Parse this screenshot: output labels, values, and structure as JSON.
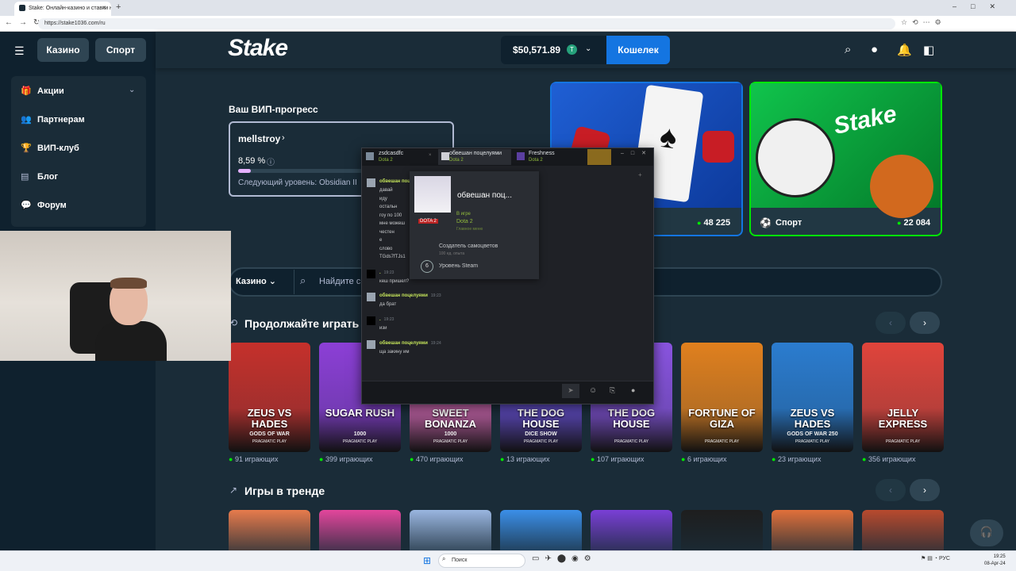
{
  "browser": {
    "tab_title": "Stake: Онлайн-казино и ставки н...",
    "url": "https://stake1036.com/ru",
    "new_tab": "+",
    "tab_close": "×"
  },
  "sidebar": {
    "casino_label": "Казино",
    "sport_label": "Спорт",
    "items": [
      {
        "label": "Акции",
        "icon": "gift-icon"
      },
      {
        "label": "Партнерам",
        "icon": "users-icon"
      },
      {
        "label": "ВИП-клуб",
        "icon": "trophy-icon"
      },
      {
        "label": "Блог",
        "icon": "blog-icon"
      },
      {
        "label": "Форум",
        "icon": "chat-icon"
      }
    ]
  },
  "header": {
    "logo": "Stake",
    "balance": "$50,571.89",
    "coin": "T",
    "wallet_label": "Кошелек"
  },
  "vip": {
    "title": "Ваш ВИП-прогресс",
    "username": "mellstroy",
    "percent_label": "8,59 %",
    "progress": 0.0859,
    "next_level": "Следующий уровень: Obsidian II"
  },
  "promo": {
    "casino_count": "48 225",
    "sport_label": "Спорт",
    "sport_count": "22 084"
  },
  "search": {
    "category": "Казино",
    "placeholder": "Найдите с"
  },
  "continue_section": {
    "title": "Продолжайте играть",
    "games": [
      {
        "name": "ZEUS VS HADES",
        "sub": "GODS OF WAR",
        "provider": "PRAGMATIC PLAY",
        "players": "91 играющих",
        "color": "#c5302b"
      },
      {
        "name": "SUGAR RUSH",
        "sub": "1000",
        "provider": "PRAGMATIC PLAY",
        "players": "399 играющих",
        "color": "#8c3fd6"
      },
      {
        "name": "SWEET BONANZA",
        "sub": "1000",
        "provider": "PRAGMATIC PLAY",
        "players": "470 играющих",
        "color": "#e06bb9"
      },
      {
        "name": "THE DOG HOUSE",
        "sub": "DICE SHOW",
        "provider": "PRAGMATIC PLAY",
        "players": "13 играющих",
        "color": "#6b4fd8"
      },
      {
        "name": "THE DOG HOUSE",
        "sub": "",
        "provider": "PRAGMATIC PLAY",
        "players": "107 играющих",
        "color": "#8a54e0"
      },
      {
        "name": "FORTUNE OF GIZA",
        "sub": "",
        "provider": "PRAGMATIC PLAY",
        "players": "6 играющих",
        "color": "#e0801e"
      },
      {
        "name": "ZEUS VS HADES",
        "sub": "GODS OF WAR 250",
        "provider": "PRAGMATIC PLAY",
        "players": "23 играющих",
        "color": "#2b7ccf"
      },
      {
        "name": "JELLY EXPRESS",
        "sub": "",
        "provider": "PRAGMATIC PLAY",
        "players": "356 играющих",
        "color": "#e0443b"
      }
    ]
  },
  "trending_section": {
    "title": "Игры в тренде",
    "colors": [
      "#e77b4c",
      "#e3469c",
      "#9ab6e0",
      "#3b8fe8",
      "#7a3fd6",
      "#1e1e1e",
      "#e0703a",
      "#b84a2e"
    ]
  },
  "steam_chat": {
    "tabs": [
      {
        "name": "zsdcasdfc",
        "game": "Dota 2"
      },
      {
        "name": "обвешан поцелуями",
        "game": "Dota 2"
      },
      {
        "name": "Freshness",
        "game": "Dota 2"
      }
    ],
    "messages": [
      {
        "author": "обвешан поцелуями",
        "time": "",
        "lines": [
          "давай",
          "иду",
          "остальн",
          "гоу по 100",
          "мне можеш",
          "честен",
          "е",
          "слово",
          "TGds7fTJs1"
        ]
      },
      {
        "author": ".",
        "time": "19:23",
        "lines": [
          "кеш пришел?"
        ]
      },
      {
        "author": "обвешан поцелуями",
        "time": "19:23",
        "lines": [
          "да брат"
        ]
      },
      {
        "author": ".",
        "time": "19:23",
        "lines": [
          "изи"
        ]
      },
      {
        "author": "обвешан поцелуями",
        "time": "19:24",
        "lines": [
          "ща закину им"
        ]
      }
    ],
    "profile": {
      "name": "обвешан поц...",
      "status": "В игре",
      "game": "Dota 2",
      "menu": "Главное меню",
      "badge_title": "Создатель самоцветов",
      "badge_xp": "100 ед. опыта",
      "level": "6",
      "level_label": "Уровень Steam",
      "dota_logo": "DOTA 2"
    }
  },
  "taskbar": {
    "search_placeholder": "Поиск",
    "lang": "РУС",
    "time": "19:25",
    "date": "08-Apr-24"
  }
}
